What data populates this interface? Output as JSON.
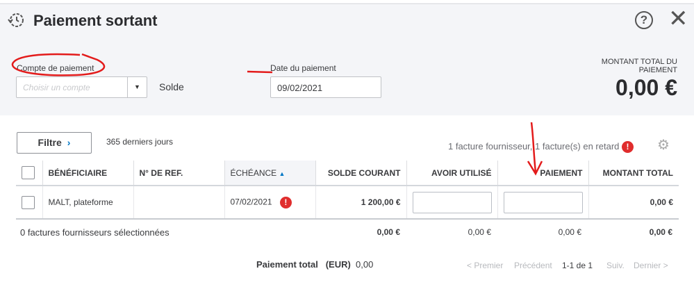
{
  "header": {
    "title": "Paiement sortant",
    "help_label": "?",
    "close_label": "✕"
  },
  "form": {
    "account_label": "Compte de paiement",
    "account_placeholder": "Choisir un compte",
    "balance_label": "Solde",
    "date_label": "Date du paiement",
    "date_value": "09/02/2021",
    "total_label": "MONTANT TOTAL DU PAIEMENT",
    "total_value": "0,00 €"
  },
  "toolbar": {
    "filter_label": "Filtre",
    "filter_chevron": "›",
    "period": "365 derniers jours",
    "summary": "1 facture fournisseur, 1 facture(s) en retard",
    "alert": "!"
  },
  "table": {
    "columns": [
      "BÉNÉFICIAIRE",
      "N° DE REF.",
      "ÉCHÉANCE",
      "SOLDE COURANT",
      "AVOIR UTILISÉ",
      "PAIEMENT",
      "MONTANT TOTAL"
    ],
    "sort_indicator": "▲",
    "rows": [
      {
        "payee": "MALT, plateforme",
        "ref": "",
        "due": "07/02/2021",
        "balance": "1 200,00 €",
        "credit": "",
        "payment": "",
        "total": "0,00 €"
      }
    ]
  },
  "footer": {
    "selected": "0 factures fournisseurs sélectionnées",
    "balance": "0,00 €",
    "credit": "0,00 €",
    "payment": "0,00 €",
    "total": "0,00 €",
    "total_payment_label": "Paiement total",
    "currency": "(EUR)",
    "total_payment_value": "0,00"
  },
  "pagination": {
    "first": "< Premier",
    "prev": "Précédent",
    "range": "1-1 de 1",
    "next": "Suiv.",
    "last": "Dernier >"
  },
  "colors": {
    "accent": "#0077c5",
    "alert": "#e02d2d",
    "annotation": "#e31b1b"
  }
}
